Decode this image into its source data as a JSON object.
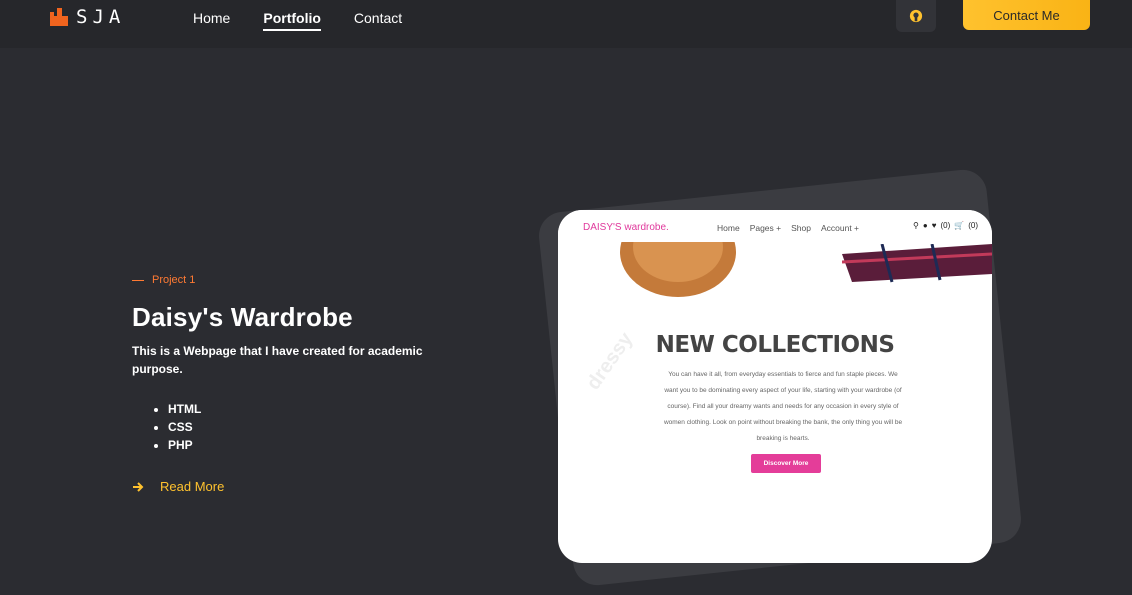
{
  "header": {
    "logo_text": "SJA",
    "nav": [
      {
        "label": "Home",
        "active": false
      },
      {
        "label": "Portfolio",
        "active": true
      },
      {
        "label": "Contact",
        "active": false
      }
    ],
    "github_icon": "github-icon",
    "contact_button": "Contact Me"
  },
  "project": {
    "eyebrow": "Project 1",
    "title": "Daisy's Wardrobe",
    "description": "This is a Webpage that I have created for academic purpose.",
    "skills": [
      "HTML",
      "CSS",
      "PHP"
    ],
    "read_more": "Read More"
  },
  "preview": {
    "brand": "DAISY'S wardrobe.",
    "nav": [
      "Home",
      "Pages +",
      "Shop",
      "Account +"
    ],
    "cart_counts": [
      "(0)",
      "(0)"
    ],
    "headline": "NEW COLLECTIONS",
    "paragraph": "You can have it all, from everyday essentials to fierce and fun staple pieces. We want you to be dominating every aspect of your life, starting with your wardrobe (of course). Find all your dreamy wants and needs for any occasion in every style of women clothing. Look on point without breaking the bank, the only thing you will be breaking is hearts.",
    "button": "Discover More"
  },
  "colors": {
    "accent": "#ffc22e",
    "eyebrow": "#ff7a33",
    "brand_pink": "#e0399c"
  }
}
